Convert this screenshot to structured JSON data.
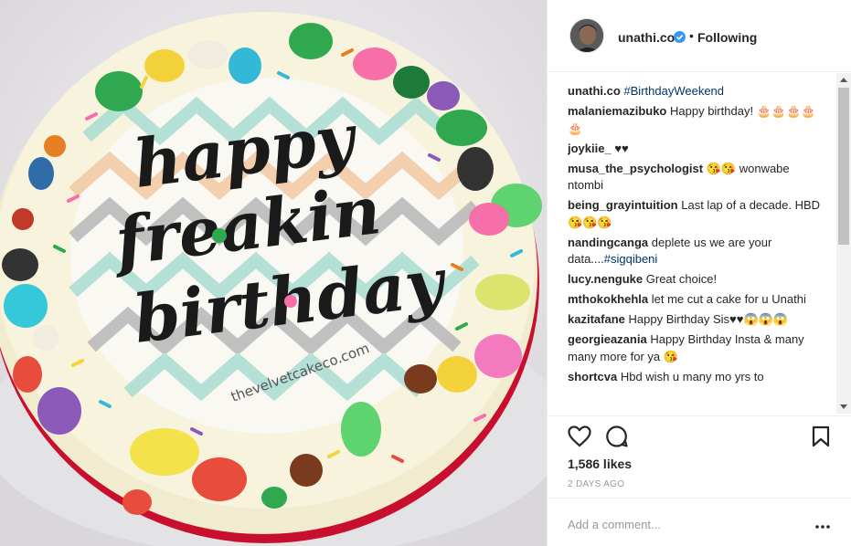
{
  "photo": {
    "cake_text_lines": [
      "happy",
      "freakin",
      "birthday"
    ],
    "bakery_text": "thevelvetcakeco.com"
  },
  "header": {
    "username": "unathi.co",
    "separator": "•",
    "follow_status": "Following"
  },
  "caption": {
    "username": "unathi.co",
    "text": "#BirthdayWeekend"
  },
  "comments": [
    {
      "username": "malaniemazibuko",
      "text": "Happy birthday! 🎂🎂🎂🎂🎂"
    },
    {
      "username": "joykiie_",
      "text": "♥♥"
    },
    {
      "username": "musa_the_psychologist",
      "text": "😘😘 wonwabe ntombi"
    },
    {
      "username": "being_grayintuition",
      "text": "Last lap of a decade. HBD 😘😘😘"
    },
    {
      "username": "nandingcanga",
      "text": "deplete us we are your data....",
      "tag": "#sigqibeni"
    },
    {
      "username": "lucy.nenguke",
      "text": "Great choice!"
    },
    {
      "username": "mthokokhehla",
      "text": "let me cut a cake for u Unathi"
    },
    {
      "username": "kazitafane",
      "text": "Happy Birthday Sis♥♥😱😱😱"
    },
    {
      "username": "georgieazania",
      "text": "Happy Birthday Insta & many many more for ya 😘"
    },
    {
      "username": "shortcva",
      "text": "Hbd wish u many mo yrs to"
    }
  ],
  "likes": "1,586 likes",
  "time_ago": "2 DAYS AGO",
  "add_comment": {
    "placeholder": "Add a comment..."
  },
  "colors": {
    "text": "#262626",
    "link": "#003569",
    "muted": "#999999",
    "verified": "#3897f0",
    "border": "#efefef"
  },
  "icons": [
    "heart-icon",
    "comment-icon",
    "bookmark-icon",
    "verified-badge-icon",
    "more-options-icon"
  ]
}
